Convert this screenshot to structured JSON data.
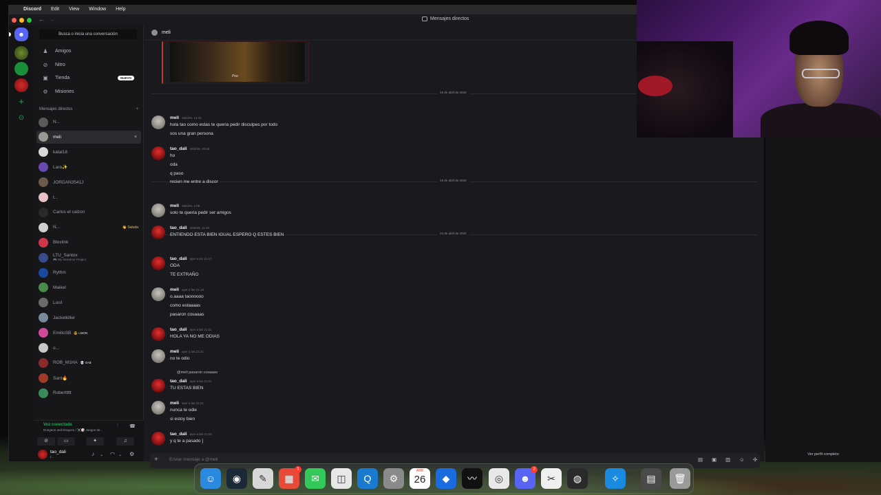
{
  "menubar": {
    "app": "Discord",
    "items": [
      "Edit",
      "View",
      "Window",
      "Help"
    ]
  },
  "window": {
    "title": "Mensajes directos"
  },
  "sidebar": {
    "search_placeholder": "Busca o inicia una conversación",
    "nav": [
      {
        "label": "Amigos",
        "icon": "friends-icon"
      },
      {
        "label": "Nitro",
        "icon": "nitro-icon"
      },
      {
        "label": "Tienda",
        "icon": "store-icon",
        "badge": "NUEVO"
      },
      {
        "label": "Misiones",
        "icon": "quests-icon"
      }
    ],
    "dm_header": "Mensajes directos",
    "dms": [
      {
        "name": "N...",
        "color": "#5a5a5a"
      },
      {
        "name": "meli",
        "color": "#9a9894",
        "active": true
      },
      {
        "name": "katal18",
        "color": "#d8d8d8"
      },
      {
        "name": "Lara✨",
        "color": "#6a4ab0"
      },
      {
        "name": "JORDAN3541J",
        "color": "#6a5a4a"
      },
      {
        "name": "t...",
        "color": "#e8c0c8"
      },
      {
        "name": "Carlos el calzon",
        "color": "#2a2a2a"
      },
      {
        "name": "N...",
        "color": "#d0d0d0",
        "tag": "👋 Saluda"
      },
      {
        "name": "Bloxlink",
        "color": "#d0364a"
      },
      {
        "name": "LTU_Santox",
        "sub": "🎮 My Streamer Project",
        "color": "#3a4a8a"
      },
      {
        "name": "Rythm",
        "color": "#1a4aa0"
      },
      {
        "name": "Maikel",
        "color": "#4a8a4a"
      },
      {
        "name": "Lord",
        "color": "#6a6a6a"
      },
      {
        "name": "Jacketkiller",
        "color": "#7a8a9a"
      },
      {
        "name": "EmilioSB",
        "inline_tag": "😎 LMON",
        "color": "#d04a9a"
      },
      {
        "name": "o...",
        "color": "#c8c8c8"
      },
      {
        "name": "ROB_M1HA",
        "inline_tag": "💀 SAB",
        "color": "#8a2a2a"
      },
      {
        "name": "Sant🔥",
        "color": "#a03a2a"
      },
      {
        "name": "Roberttttt",
        "color": "#3a8a5a"
      }
    ],
    "voice": {
      "status": "Voz conectada",
      "channel": "Dungeon and Dragons / ⚔️🎲 Juegos de..."
    },
    "user": {
      "name": "tao_dali",
      "status": "t..."
    }
  },
  "chat": {
    "header_name": "meli",
    "embed_caption": "Poe",
    "dividers": [
      "18 de abril de 2026",
      "19 de abril de 2026",
      "23 de abril de 2026"
    ],
    "messages": [
      {
        "author": "meli",
        "time": "18/4/26, 14:16",
        "lines": [
          "hola tao como estas te queria pedir disculpes por todo",
          "sos una gran persona"
        ]
      },
      {
        "author": "tao_dali",
        "time": "18/4/26, 20:26",
        "lines": [
          "ho",
          "oda",
          "q paso",
          "recien me entre a discor"
        ]
      },
      {
        "author": "meli",
        "time": "19/4/26, 1:08",
        "lines": [
          "solo te queria pedir ser amigos"
        ]
      },
      {
        "author": "tao_dali",
        "time": "19/4/26, 11:29",
        "lines": [
          "ENTIENDO ESTA BIEN  IGUAL ESPERO Q ESTES BIEN"
        ]
      },
      {
        "author": "tao_dali",
        "time": "ayer a las 21:17",
        "lines": [
          "ODA",
          "TE EXTRAÑO"
        ]
      },
      {
        "author": "meli",
        "time": "ayer a las 21:19",
        "lines": [
          "o.aaaa taoooooo",
          "como estaaaas",
          "pasaron cosaaas"
        ]
      },
      {
        "author": "tao_dali",
        "time": "ayer a las 21:21",
        "lines": [
          "HOLA YA NO ME ODIAS"
        ]
      },
      {
        "author": "meli",
        "time": "ayer a las 21:21",
        "lines": [
          "no te odio"
        ]
      },
      {
        "author": "tao_dali",
        "time": "ayer a las 21:21",
        "reply": "@meli  pasaron cosaaas",
        "lines": [
          "TU ESTAS BIEN"
        ]
      },
      {
        "author": "meli",
        "time": "ayer a las 21:21",
        "lines": [
          "nunca te odie",
          "si estoy bien"
        ]
      },
      {
        "author": "tao_dali",
        "time": "ayer a las 21:24",
        "lines": [
          "y q te a pasado ]"
        ]
      }
    ],
    "composer_placeholder": "Enviar mensaje a @meli"
  },
  "right_panel": {
    "caption": "Ver perfil completo"
  },
  "dock": {
    "calendar": {
      "month": "ABR",
      "day": "26"
    },
    "apps": [
      {
        "name": "finder-icon",
        "color": "#2a8ae0",
        "glyph": "☺"
      },
      {
        "name": "steam-icon",
        "color": "#1b2838",
        "glyph": "◉"
      },
      {
        "name": "notes-icon",
        "color": "#d8d8d8",
        "glyph": "✎"
      },
      {
        "name": "launchpad-icon",
        "color": "#e84a3a",
        "glyph": "▦",
        "badge": "1"
      },
      {
        "name": "messages-icon",
        "color": "#34c759",
        "glyph": "✉"
      },
      {
        "name": "screenshot-icon",
        "color": "#e8e8e8",
        "glyph": "◫"
      },
      {
        "name": "quicktime-icon",
        "color": "#1a7ad0",
        "glyph": "Q"
      },
      {
        "name": "system-settings-icon",
        "color": "#8a8a8a",
        "glyph": "⚙"
      },
      {
        "name": "calendar-icon",
        "color": "#ffffff",
        "glyph": ""
      },
      {
        "name": "roblox-icon",
        "color": "#1a6ae0",
        "glyph": "◆"
      },
      {
        "name": "capcut-tool-icon",
        "color": "#111111",
        "glyph": "〰"
      },
      {
        "name": "chrome-icon",
        "color": "#e8e8e8",
        "glyph": "◎"
      },
      {
        "name": "discord-icon",
        "color": "#5865f2",
        "glyph": "☻",
        "badge": "2"
      },
      {
        "name": "capcut-icon",
        "color": "#f0f0f0",
        "glyph": "✂"
      },
      {
        "name": "obs-icon",
        "color": "#2a2a2a",
        "glyph": "◍"
      },
      {
        "name": "safari-icon",
        "color": "#1a8ae0",
        "glyph": "✧"
      },
      {
        "name": "downloads-icon",
        "color": "#4a4a4a",
        "glyph": "▤"
      },
      {
        "name": "trash-icon",
        "color": "#9a9a9a",
        "glyph": "🗑"
      }
    ]
  }
}
